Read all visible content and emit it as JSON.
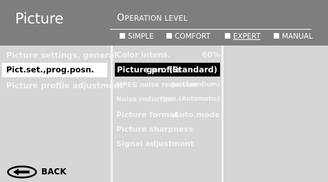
{
  "header": {
    "title": "Picture",
    "operation_level": {
      "first": "O",
      "rest": "PERATION LEVEL"
    },
    "modes": [
      {
        "label": "SIMPLE",
        "active": false
      },
      {
        "label": "COMFORT",
        "active": false
      },
      {
        "label": "EXPERT",
        "active": true
      },
      {
        "label": "MANUAL",
        "active": false
      }
    ]
  },
  "menu": {
    "items": [
      {
        "label": "Picture settings, general",
        "selected": false
      },
      {
        "label": "Pict.set.,prog.posn.",
        "selected": true
      },
      {
        "label": "Picture profile adjustment",
        "selected": false
      }
    ]
  },
  "submenu": {
    "rows": [
      {
        "label": "Color intens.",
        "value": "60%",
        "selected": false
      },
      {
        "label": "Picture profile",
        "value": "gen. (Standard)",
        "selected": true
      },
      {
        "label": "MPEG noise reduction",
        "value": "gen.(medium)",
        "selected": false
      },
      {
        "label": "Noise reduction",
        "value": "gen.(Automatic)",
        "selected": false
      },
      {
        "label": "Picture format",
        "value": "Auto.mode",
        "selected": false
      },
      {
        "label": "Picture sharpness",
        "value": "",
        "selected": false
      },
      {
        "label": "Signal adjustment",
        "value": "",
        "selected": false
      }
    ]
  },
  "footer": {
    "back_label": "BACK",
    "back_icon": "back-arrow-icon"
  },
  "colors": {
    "header_bg": "#7e7e7e",
    "panel_bg": "#d6d6d6",
    "text_muted": "#f3f3f3",
    "highlight_white": "#ffffff",
    "highlight_black": "#000000"
  }
}
